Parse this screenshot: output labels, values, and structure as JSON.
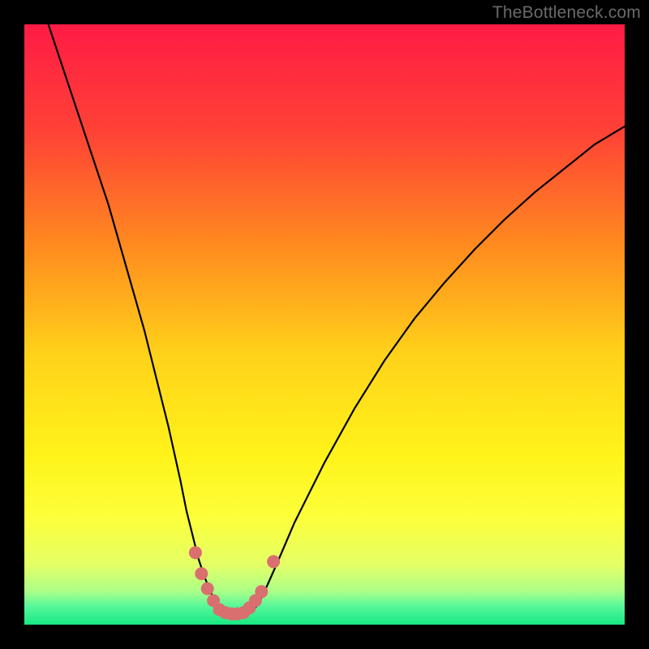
{
  "watermark": "TheBottleneck.com",
  "chart_data": {
    "type": "line",
    "title": "",
    "xlabel": "",
    "ylabel": "",
    "xlim": [
      0,
      100
    ],
    "ylim": [
      0,
      100
    ],
    "grid": false,
    "series": [
      {
        "name": "bottleneck-curve",
        "x": [
          4,
          6,
          8,
          10,
          12,
          14,
          16,
          18,
          20,
          22,
          24,
          26,
          27,
          28,
          29,
          30,
          31,
          32,
          33,
          34,
          35,
          36,
          37,
          38,
          39,
          40,
          42,
          45,
          50,
          55,
          60,
          65,
          70,
          75,
          80,
          85,
          90,
          95,
          100
        ],
        "values": [
          100,
          94,
          88,
          82,
          76,
          70,
          63,
          56,
          49,
          41,
          33,
          24,
          19,
          15,
          11,
          8,
          5.5,
          3.5,
          2,
          1.4,
          1.2,
          1.2,
          1.5,
          2.2,
          3.5,
          5.5,
          10,
          17,
          27,
          36,
          44,
          51,
          57,
          62.5,
          67.5,
          72,
          76,
          80,
          83
        ]
      }
    ],
    "markers": [
      {
        "x": 28.5,
        "y": 12,
        "r": 1
      },
      {
        "x": 29.5,
        "y": 8.5,
        "r": 1
      },
      {
        "x": 30.5,
        "y": 6,
        "r": 1
      },
      {
        "x": 31.5,
        "y": 4,
        "r": 1
      },
      {
        "x": 32.5,
        "y": 2.5,
        "r": 1
      },
      {
        "x": 33.5,
        "y": 2,
        "r": 1
      },
      {
        "x": 34.5,
        "y": 1.8,
        "r": 1
      },
      {
        "x": 35.5,
        "y": 1.8,
        "r": 1
      },
      {
        "x": 36.5,
        "y": 2,
        "r": 1
      },
      {
        "x": 37.5,
        "y": 2.8,
        "r": 1
      },
      {
        "x": 38.5,
        "y": 4,
        "r": 1
      },
      {
        "x": 39.5,
        "y": 5.5,
        "r": 1
      },
      {
        "x": 41.5,
        "y": 10.5,
        "r": 1
      }
    ],
    "background_gradient": {
      "stops": [
        {
          "offset": 0.0,
          "color": "#ff1b45"
        },
        {
          "offset": 0.18,
          "color": "#ff4236"
        },
        {
          "offset": 0.38,
          "color": "#ff8f1e"
        },
        {
          "offset": 0.55,
          "color": "#ffd21a"
        },
        {
          "offset": 0.72,
          "color": "#fff31a"
        },
        {
          "offset": 0.82,
          "color": "#fdff3a"
        },
        {
          "offset": 0.9,
          "color": "#e4ff66"
        },
        {
          "offset": 0.945,
          "color": "#aaff88"
        },
        {
          "offset": 0.97,
          "color": "#55f79a"
        },
        {
          "offset": 1.0,
          "color": "#17e884"
        }
      ]
    },
    "colors": {
      "curve": "#000000",
      "markers": "#d96f6f",
      "frame": "#000000"
    }
  }
}
